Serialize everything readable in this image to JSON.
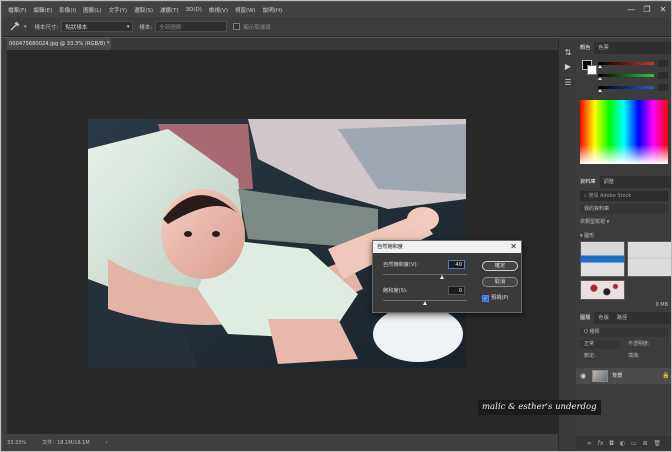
{
  "menubar": {
    "items": [
      "檔案(F)",
      "編輯(E)",
      "影像(I)",
      "圖層(L)",
      "文字(Y)",
      "選取(S)",
      "濾鏡(T)",
      "3D(D)",
      "檢視(V)",
      "視窗(W)",
      "說明(H)"
    ],
    "window_controls": [
      "—",
      "❐",
      "✕"
    ]
  },
  "options_bar": {
    "sample_size_label": "樣本尺寸:",
    "sample_size_value": "點狀樣本",
    "sample_label": "樣本:",
    "sample_value": "全部圖層",
    "show_ring_label": "顯示取樣環"
  },
  "document_tab": {
    "title": "000475680024.jpg @ 33.3% (RGB/8) *",
    "close": "✕"
  },
  "status_bar": {
    "zoom": "33.33%",
    "doc_size": "文件：18.1M/18.1M",
    "arrow": "›"
  },
  "color_panel": {
    "tabs": [
      "顏色",
      "色票"
    ],
    "colors": {
      "red": "#c0392b",
      "green": "#2ecc40",
      "blue": "#2a57d6"
    }
  },
  "libraries_panel": {
    "tabs": [
      "資料庫",
      "調整"
    ],
    "search_placeholder": "搜尋 Adobe Stock",
    "library_name": "我的資料庫",
    "filter_label": "依類型檢視",
    "group_label": "圖形",
    "size": "9 MB"
  },
  "layers_panel": {
    "tabs": [
      "圖層",
      "色版",
      "路徑"
    ],
    "kind_filter": "Q 種類",
    "blend_mode": "正常",
    "opacity_label": "不透明度:",
    "lock_label": "鎖定:",
    "fill_label": "填滿:",
    "layer_name": "背景"
  },
  "dialog": {
    "title": "自然飽和度",
    "vibrance_label": "自然飽和度(V):",
    "vibrance_value": "40",
    "vibrance_level": 0.7,
    "saturation_label": "飽和度(S):",
    "saturation_value": "0",
    "saturation_level": 0.5,
    "ok_label": "確定",
    "cancel_label": "取消",
    "preview_label": "預視(P)"
  },
  "watermark": {
    "text": "malic & esther's underdog"
  }
}
